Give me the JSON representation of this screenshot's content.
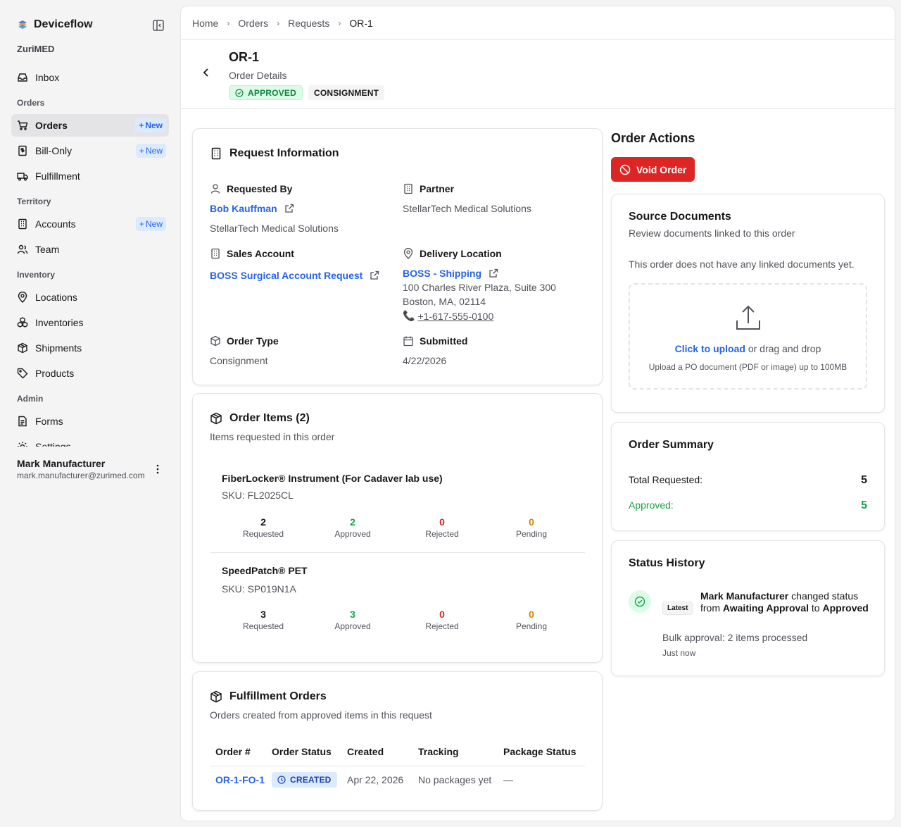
{
  "app": {
    "name": "Deviceflow",
    "org": "ZuriMED"
  },
  "sidebar": {
    "inbox": "Inbox",
    "sections": {
      "orders": "Orders",
      "territory": "Territory",
      "inventory": "Inventory",
      "admin": "Admin"
    },
    "items": {
      "orders": "Orders",
      "bill_only": "Bill-Only",
      "fulfillment": "Fulfillment",
      "accounts": "Accounts",
      "team": "Team",
      "locations": "Locations",
      "inventories": "Inventories",
      "shipments": "Shipments",
      "products": "Products",
      "forms": "Forms",
      "settings": "Settings"
    },
    "new_label": "New",
    "user": {
      "name": "Mark Manufacturer",
      "email": "mark.manufacturer@zurimed.com"
    }
  },
  "breadcrumb": [
    "Home",
    "Orders",
    "Requests",
    "OR-1"
  ],
  "header": {
    "title": "OR-1",
    "subtitle": "Order Details",
    "status": "APPROVED",
    "type": "CONSIGNMENT"
  },
  "request_info": {
    "title": "Request Information",
    "requested_by_label": "Requested By",
    "requested_by": "Bob Kauffman",
    "requested_by_org": "StellarTech Medical Solutions",
    "partner_label": "Partner",
    "partner": "StellarTech Medical Solutions",
    "sales_account_label": "Sales Account",
    "sales_account": "BOSS Surgical Account Request",
    "delivery_label": "Delivery Location",
    "delivery_name": "BOSS - Shipping",
    "delivery_addr1": "100 Charles River Plaza, Suite 300",
    "delivery_addr2": "Boston, MA, 02114",
    "delivery_phone": "+1-617-555-0100",
    "order_type_label": "Order Type",
    "order_type": "Consignment",
    "submitted_label": "Submitted",
    "submitted": "4/22/2026"
  },
  "order_items": {
    "title": "Order Items (2)",
    "subtitle": "Items requested in this order",
    "labels": {
      "requested": "Requested",
      "approved": "Approved",
      "rejected": "Rejected",
      "pending": "Pending"
    },
    "items": [
      {
        "name": "FiberLocker® Instrument (For Cadaver lab use)",
        "sku": "SKU: FL2025CL",
        "requested": "2",
        "approved": "2",
        "rejected": "0",
        "pending": "0"
      },
      {
        "name": "SpeedPatch® PET",
        "sku": "SKU: SP019N1A",
        "requested": "3",
        "approved": "3",
        "rejected": "0",
        "pending": "0"
      }
    ]
  },
  "fulfillment": {
    "title": "Fulfillment Orders",
    "subtitle": "Orders created from approved items in this request",
    "columns": [
      "Order #",
      "Order Status",
      "Created",
      "Tracking",
      "Package Status"
    ],
    "rows": [
      {
        "order": "OR-1-FO-1",
        "status": "CREATED",
        "created": "Apr 22, 2026",
        "tracking": "No packages yet",
        "package": "—"
      }
    ]
  },
  "actions": {
    "title": "Order Actions",
    "void": "Void Order"
  },
  "source_docs": {
    "title": "Source Documents",
    "subtitle": "Review documents linked to this order",
    "empty": "This order does not have any linked documents yet.",
    "upload_link": "Click to upload",
    "upload_rest": "or drag and drop",
    "upload_hint": "Upload a PO document (PDF or image) up to 100MB"
  },
  "summary": {
    "title": "Order Summary",
    "total_label": "Total Requested:",
    "total": "5",
    "approved_label": "Approved:",
    "approved": "5"
  },
  "history": {
    "title": "Status History",
    "latest": "Latest",
    "actor": "Mark Manufacturer",
    "changed": "changed status",
    "from_word": "from",
    "from": "Awaiting Approval",
    "to_word": "to",
    "to": "Approved",
    "note": "Bulk approval: 2 items processed",
    "time": "Just now"
  },
  "colors": {
    "accent": "#2563eb",
    "approved": "#16a34a",
    "rejected": "#dc2626",
    "pending": "#ca8a04",
    "danger": "#dc2626"
  }
}
